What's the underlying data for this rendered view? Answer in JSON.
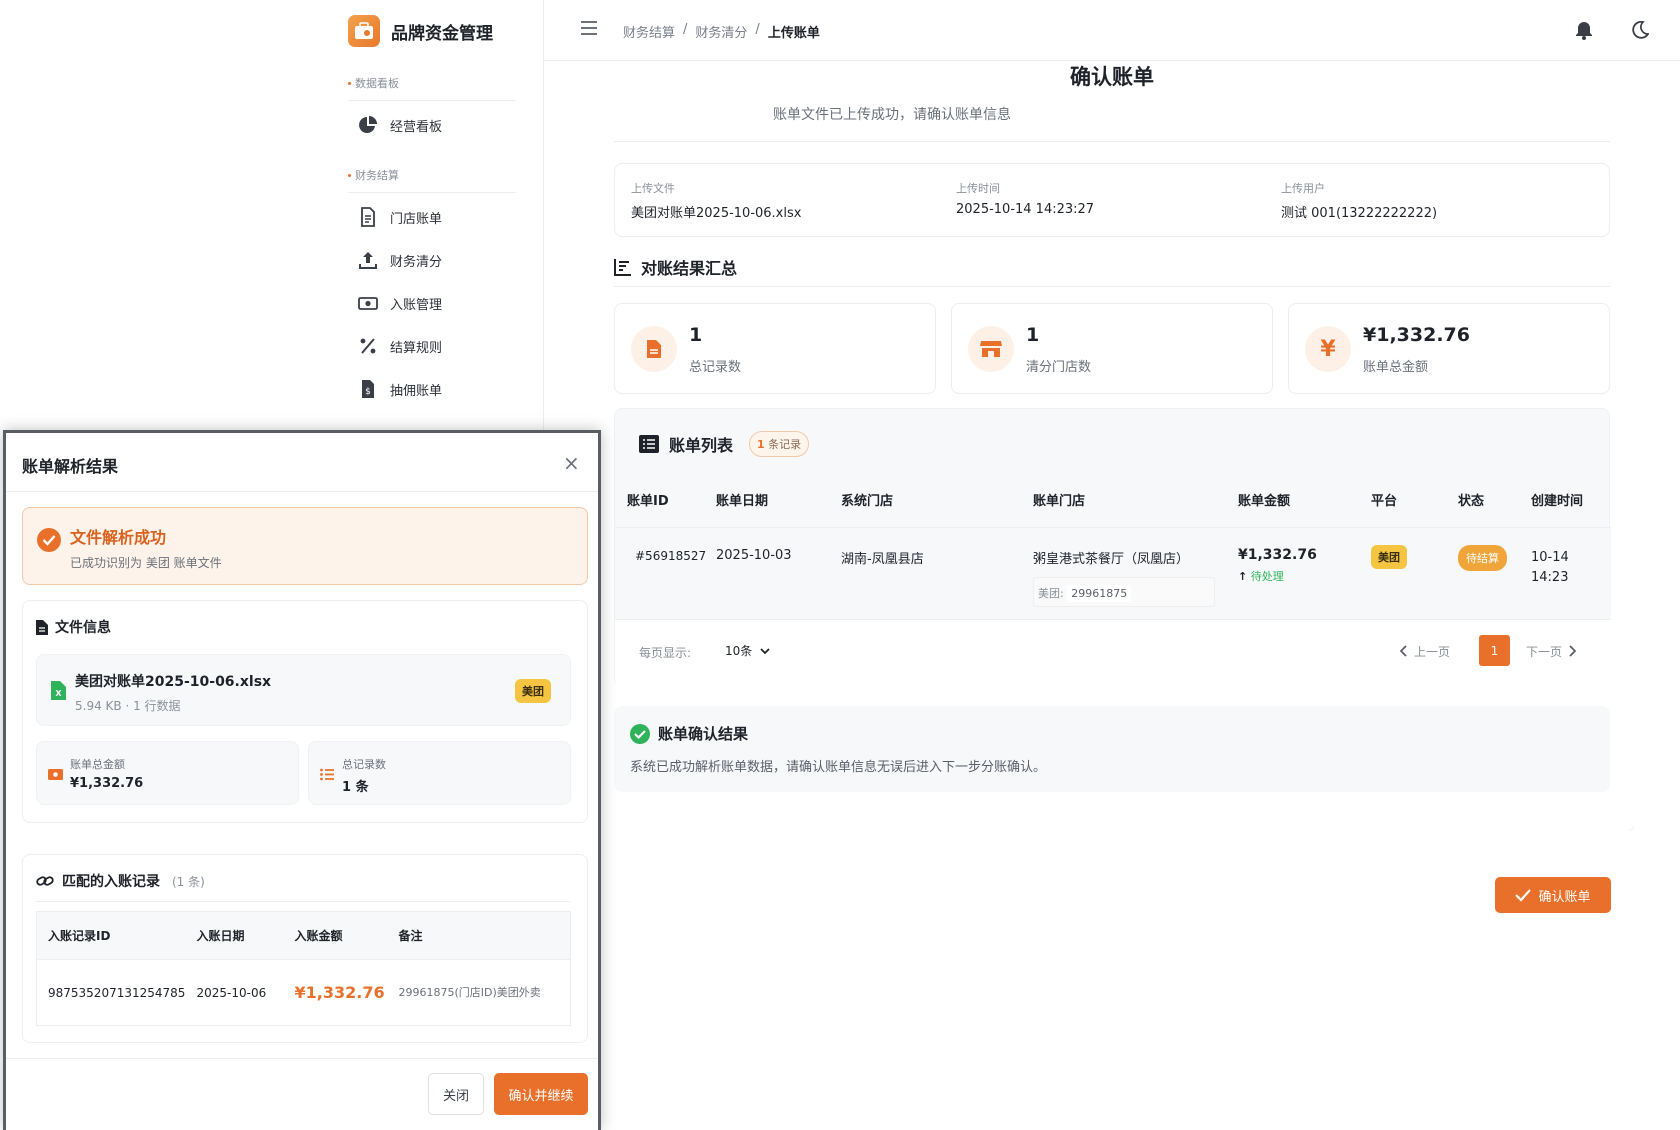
{
  "sidebar": {
    "brand": "品牌资金管理",
    "sections": [
      {
        "title": "数据看板",
        "items": [
          {
            "label": "经营看板",
            "icon": "pie-chart-icon"
          }
        ]
      },
      {
        "title": "财务结算",
        "items": [
          {
            "label": "门店账单",
            "icon": "document-icon"
          },
          {
            "label": "财务清分",
            "icon": "upload-icon"
          },
          {
            "label": "入账管理",
            "icon": "money-icon"
          },
          {
            "label": "结算规则",
            "icon": "percent-icon"
          },
          {
            "label": "抽佣账单",
            "icon": "invoice-dollar-icon"
          }
        ]
      }
    ]
  },
  "topbar": {
    "breadcrumb": [
      "财务结算",
      "财务清分",
      "上传账单"
    ],
    "sep": "/"
  },
  "page": {
    "title": "确认账单",
    "subtitle": "账单文件已上传成功，请确认账单信息",
    "upload": {
      "file_label": "上传文件",
      "file": "美团对账单2025-10-06.xlsx",
      "time_label": "上传时间",
      "time": "2025-10-14 14:23:27",
      "user_label": "上传用户",
      "user": "测试 001(13222222222)"
    },
    "summary_title": "对账结果汇总",
    "stats": [
      {
        "value": "1",
        "label": "总记录数",
        "icon": "file-icon"
      },
      {
        "value": "1",
        "label": "清分门店数",
        "icon": "store-icon"
      },
      {
        "value": "¥1,332.76",
        "label": "账单总金额",
        "icon": "yen-icon"
      }
    ],
    "list": {
      "title": "账单列表",
      "count_num": "1",
      "count_text": "条记录",
      "headers": [
        "账单ID",
        "账单日期",
        "系统门店",
        "账单门店",
        "账单金额",
        "平台",
        "状态",
        "创建时间"
      ],
      "row": {
        "id": "#56918527",
        "date": "2025-10-03",
        "sys_store": "湖南-凤凰县店",
        "bill_store": "粥皇港式茶餐厅（凤凰店）",
        "platform_code_label": "美团:",
        "platform_code": "29961875",
        "amount": "¥1,332.76",
        "amount_status": "待处理",
        "platform": "美团",
        "status": "待结算",
        "created_1": "10-14",
        "created_2": "14:23"
      },
      "page_size_label": "每页显示:",
      "page_size": "10条",
      "prev": "上一页",
      "current_page": "1",
      "next": "下一页"
    },
    "confirm_result": {
      "title": "账单确认结果",
      "text": "系统已成功解析账单数据，请确认账单信息无误后进入下一步分账确认。"
    },
    "confirm_button": "确认账单"
  },
  "modal": {
    "title": "账单解析结果",
    "close_glyph": "×",
    "success_title": "文件解析成功",
    "success_sub": "已成功识别为 美团 账单文件",
    "file_info_title": "文件信息",
    "file_name": "美团对账单2025-10-06.xlsx",
    "file_meta": "5.94 KB · 1 行数据",
    "file_tag": "美团",
    "amount_label": "账单总金额",
    "amount": "¥1,332.76",
    "count_label": "总记录数",
    "count": "1 条",
    "match_title": "匹配的入账记录",
    "match_count": "(1 条)",
    "match_headers": [
      "入账记录ID",
      "入账日期",
      "入账金额",
      "备注"
    ],
    "match_row": {
      "id": "987535207131254785",
      "date": "2025-10-06",
      "amount": "¥1,332.76",
      "note": "29961875(门店ID)美团外卖"
    },
    "close_button": "关闭",
    "continue_button": "确认并继续"
  },
  "colors": {
    "accent": "#e8702a",
    "success": "#2fb35a",
    "tag_yellow": "#f5c542",
    "status_orange": "#f0a53a"
  }
}
